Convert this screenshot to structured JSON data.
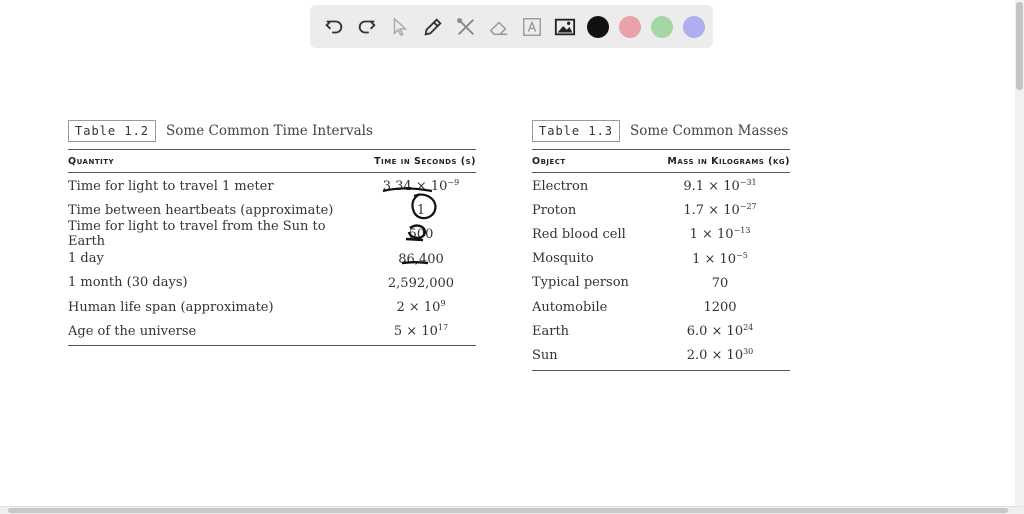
{
  "toolbar": {
    "tools": [
      {
        "name": "undo-icon"
      },
      {
        "name": "redo-icon"
      },
      {
        "name": "pointer-icon"
      },
      {
        "name": "pencil-icon"
      },
      {
        "name": "tools-icon"
      },
      {
        "name": "eraser-icon"
      },
      {
        "name": "text-icon"
      },
      {
        "name": "image-icon"
      }
    ],
    "colors": [
      "#111111",
      "#eaa1a8",
      "#a6d6a4",
      "#b0aef0"
    ]
  },
  "table_a": {
    "tag": "Table 1.2",
    "title": "Some Common Time Intervals",
    "col1": "Quantity",
    "col2": "Time in Seconds (s)",
    "rows": [
      {
        "label": "Time for light to travel 1 meter",
        "base": "3.34 × 10",
        "exp": "−9"
      },
      {
        "label": "Time between heartbeats (approximate)",
        "base": "1",
        "exp": ""
      },
      {
        "label": "Time for light to travel from the Sun to Earth",
        "base": "500",
        "exp": ""
      },
      {
        "label": "1 day",
        "base": "86,400",
        "exp": ""
      },
      {
        "label": "1 month (30 days)",
        "base": "2,592,000",
        "exp": ""
      },
      {
        "label": "Human life span (approximate)",
        "base": "2 × 10",
        "exp": "9"
      },
      {
        "label": "Age of the universe",
        "base": "5 × 10",
        "exp": "17"
      }
    ]
  },
  "table_b": {
    "tag": "Table 1.3",
    "title": "Some Common Masses",
    "col1": "Object",
    "col2": "Mass in Kilograms (kg)",
    "rows": [
      {
        "label": "Electron",
        "base": "9.1 × 10",
        "exp": "−31"
      },
      {
        "label": "Proton",
        "base": "1.7 × 10",
        "exp": "−27"
      },
      {
        "label": "Red blood cell",
        "base": "1 × 10",
        "exp": "−13"
      },
      {
        "label": "Mosquito",
        "base": "1 × 10",
        "exp": "−5"
      },
      {
        "label": "Typical person",
        "base": "70",
        "exp": ""
      },
      {
        "label": "Automobile",
        "base": "1200",
        "exp": ""
      },
      {
        "label": "Earth",
        "base": "6.0 × 10",
        "exp": "24"
      },
      {
        "label": "Sun",
        "base": "2.0 × 10",
        "exp": "30"
      }
    ]
  }
}
